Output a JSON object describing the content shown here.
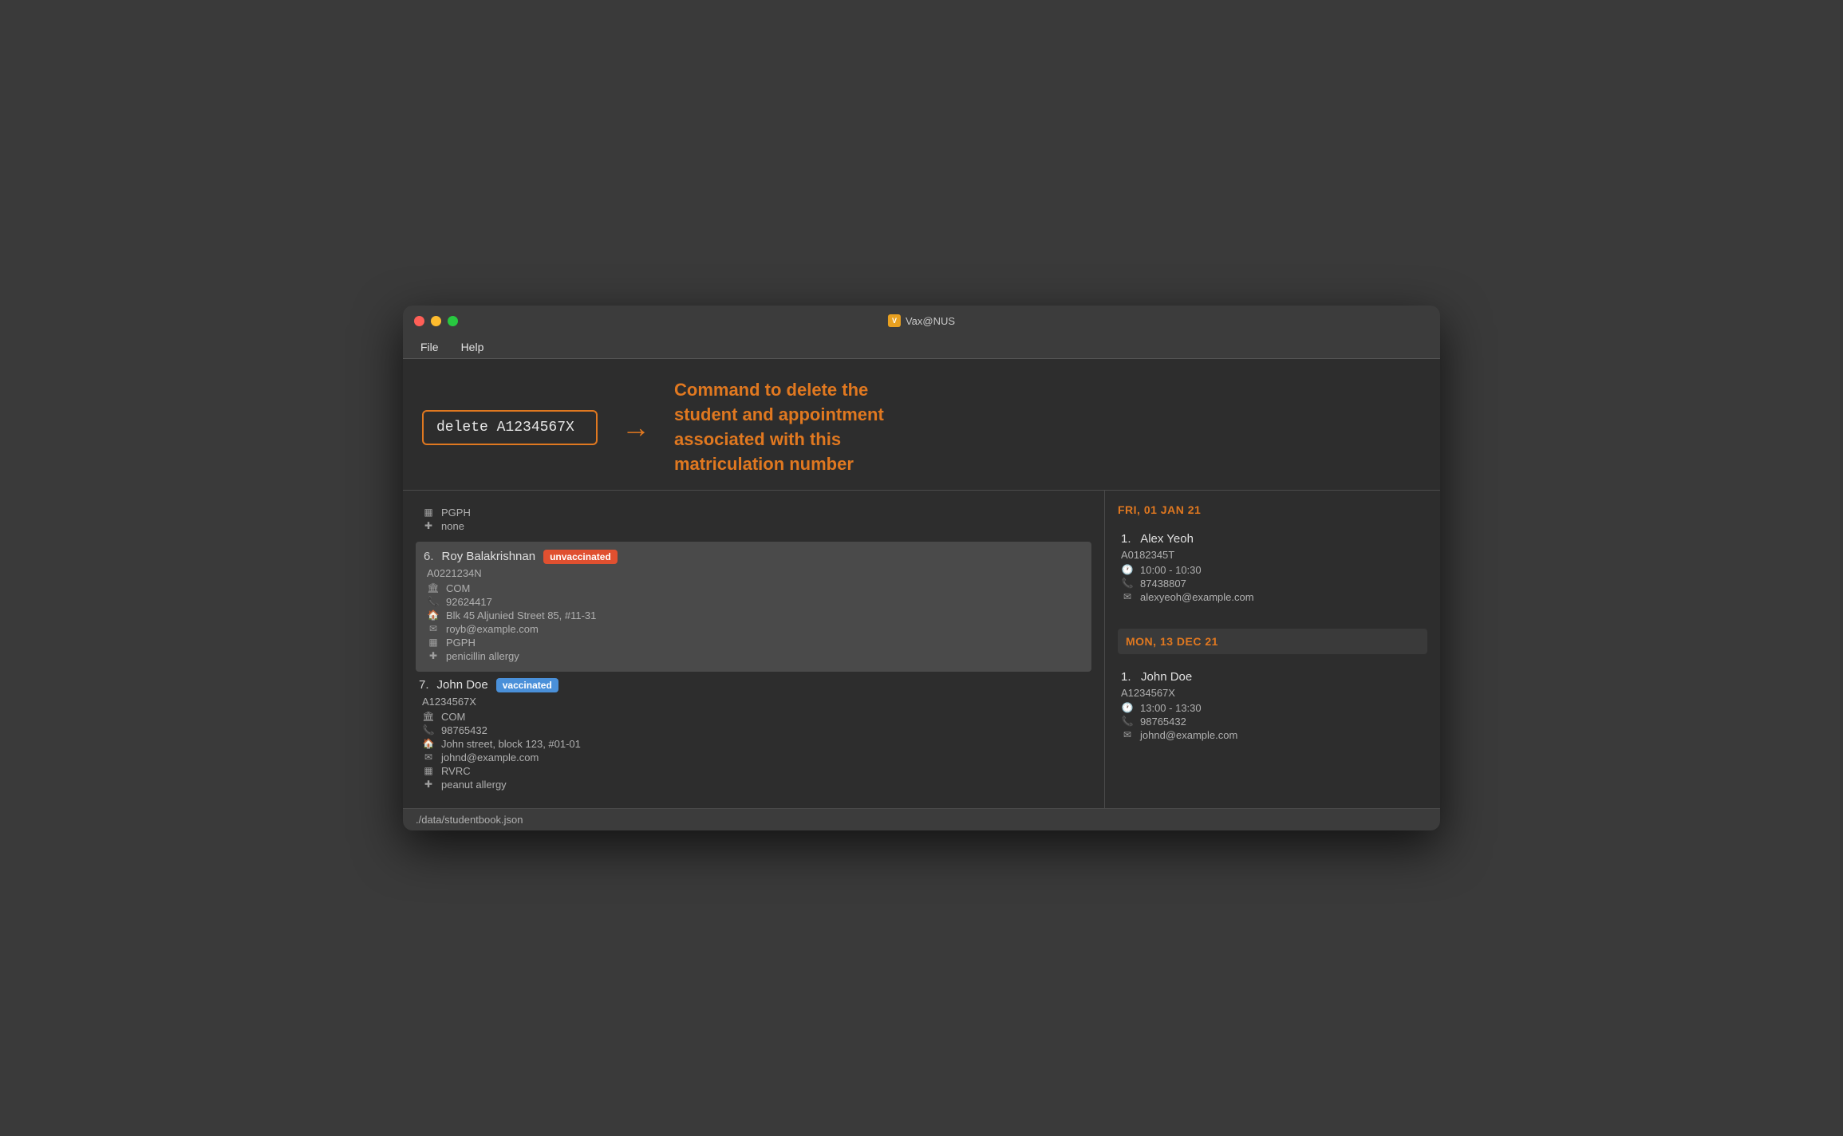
{
  "window": {
    "title": "Vax@NUS",
    "title_icon": "🏥"
  },
  "menu": {
    "items": [
      "File",
      "Help"
    ]
  },
  "command": {
    "input_value": "delete A1234567X",
    "description_line1": "Command to delete the",
    "description_line2": "student and appointment",
    "description_line3": "associated with this",
    "description_line4": "matriculation number"
  },
  "students": [
    {
      "number": "6.",
      "name": "Roy Balakrishnan",
      "badge": "unvaccinated",
      "badge_type": "unvaccinated",
      "id": "A0221234N",
      "faculty": "COM",
      "phone": "92624417",
      "address": "Blk 45 Aljunied Street 85, #11-31",
      "email": "royb@example.com",
      "hall": "PGPH",
      "allergy": "penicillin allergy",
      "highlighted": true
    },
    {
      "number": "7.",
      "name": "John Doe",
      "badge": "vaccinated",
      "badge_type": "vaccinated",
      "id": "A1234567X",
      "faculty": "COM",
      "phone": "98765432",
      "address": "John street, block 123, #01-01",
      "email": "johnd@example.com",
      "hall": "RVRC",
      "allergy": "peanut allergy",
      "highlighted": false
    }
  ],
  "prev_student_partial": {
    "hall": "PGPH",
    "allergy": "none"
  },
  "appointments": [
    {
      "date_label": "FRI, 01 JAN 21",
      "entries": [
        {
          "number": "1.",
          "name": "Alex Yeoh",
          "id": "A0182345T",
          "time": "10:00 - 10:30",
          "phone": "87438807",
          "email": "alexyeoh@example.com"
        }
      ]
    },
    {
      "date_label": "MON, 13 DEC 21",
      "entries": [
        {
          "number": "1.",
          "name": "John Doe",
          "id": "A1234567X",
          "time": "13:00 - 13:30",
          "phone": "98765432",
          "email": "johnd@example.com"
        }
      ]
    }
  ],
  "status_bar": {
    "text": "./data/studentbook.json"
  },
  "icons": {
    "building": "🏛",
    "phone": "📞",
    "home": "🏠",
    "email": "✉",
    "hospital": "🏥",
    "medical": "➕",
    "clock": "🕐"
  }
}
